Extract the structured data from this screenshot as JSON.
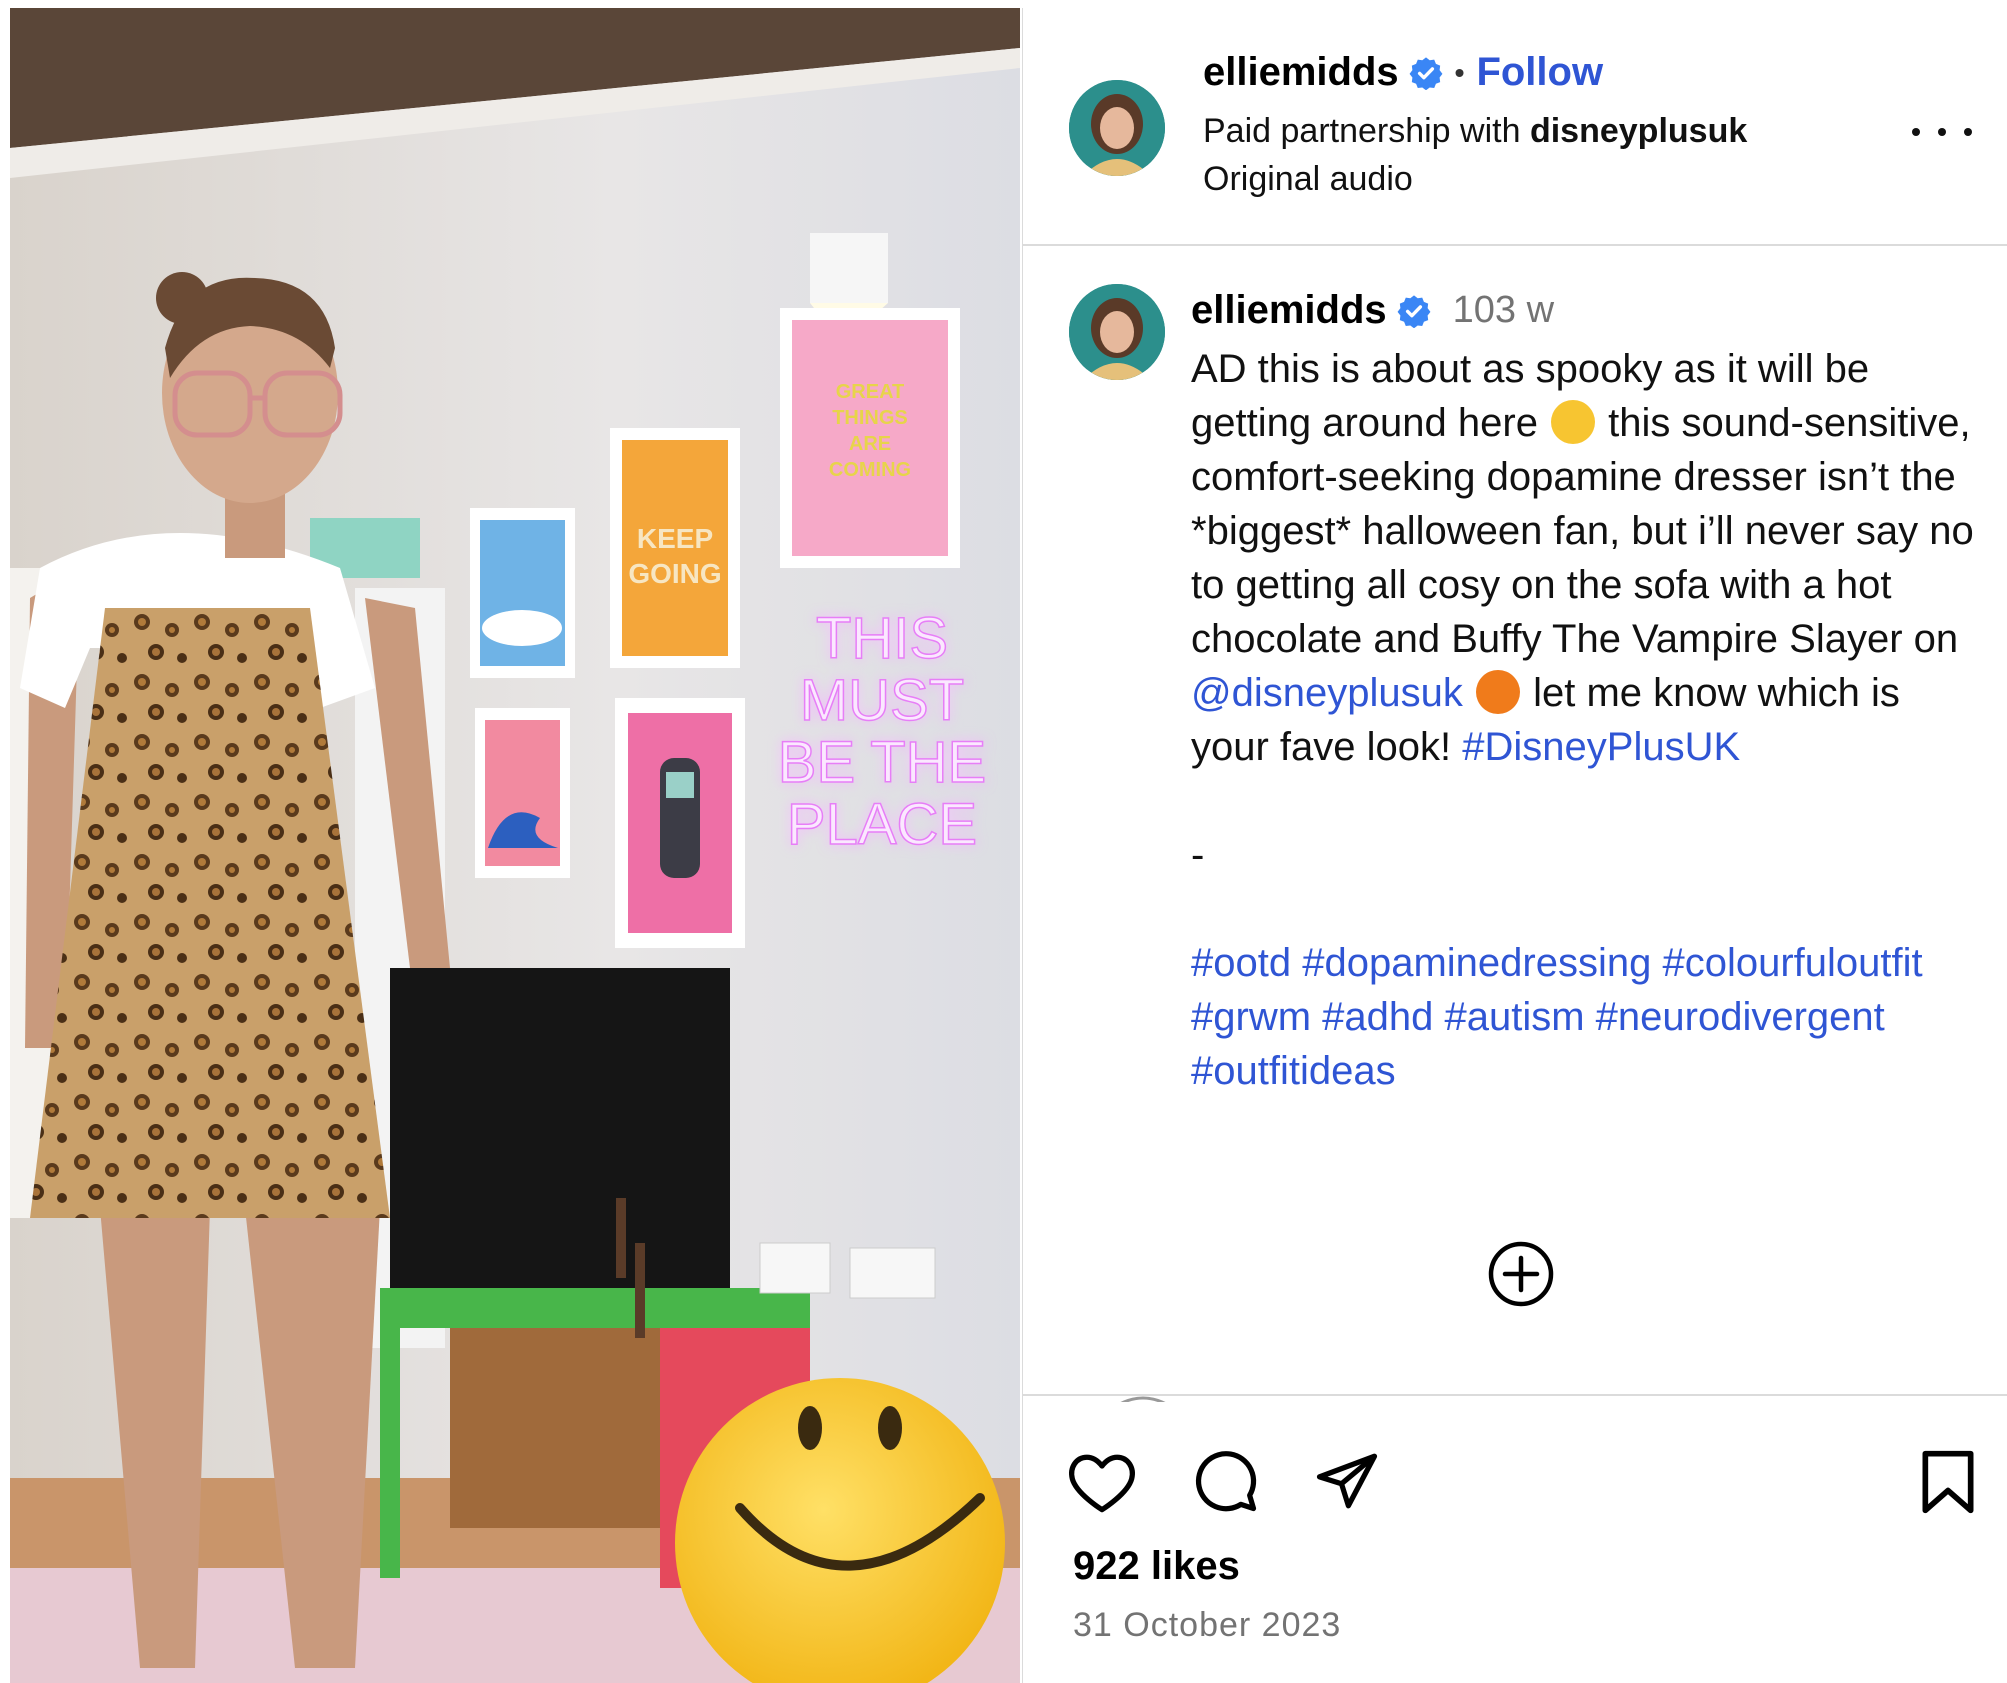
{
  "header": {
    "username": "elliemidds",
    "separator": "•",
    "follow_label": "Follow",
    "partnership_prefix": "Paid partnership with",
    "partnership_brand": "disneyplusuk",
    "audio": "Original audio"
  },
  "media": {
    "neon_sign": [
      "THIS",
      "MUST",
      "BE THE",
      "PLACE"
    ],
    "poster_keep": [
      "KEEP",
      "GOING"
    ],
    "poster_great": [
      "GREAT",
      "THINGS",
      "ARE",
      "COMING"
    ]
  },
  "caption": {
    "username": "elliemidds",
    "time": "103 w",
    "segments": {
      "p1_a": "AD this is about as spooky as it will be getting around here ",
      "p1_b": " this sound-sensitive, comfort-seeking dopamine dresser isn’t the *biggest* halloween fan, but i’ll never say no to getting all cosy on the sofa with a hot chocolate and Buffy The Vampire Slayer on ",
      "mention": "@disneyplusuk",
      "p1_c": " let me know which is your fave look! ",
      "hashtag_main": "#DisneyPlusUK",
      "dash": "-",
      "hashtags_line": "#ootd #dopaminedressing #colourfuloutfit #grwm #adhd #autism #neurodivergent #outfitideas"
    }
  },
  "actions": {
    "icons": [
      "heart-icon",
      "comment-icon",
      "share-icon",
      "bookmark-icon"
    ]
  },
  "footer": {
    "likes": "922 likes",
    "date": "31 October 2023"
  },
  "colors": {
    "link_blue": "#2f55d4",
    "verified_blue": "#3a86f5",
    "muted_gray": "#737373",
    "divider": "#dbdbdb"
  }
}
